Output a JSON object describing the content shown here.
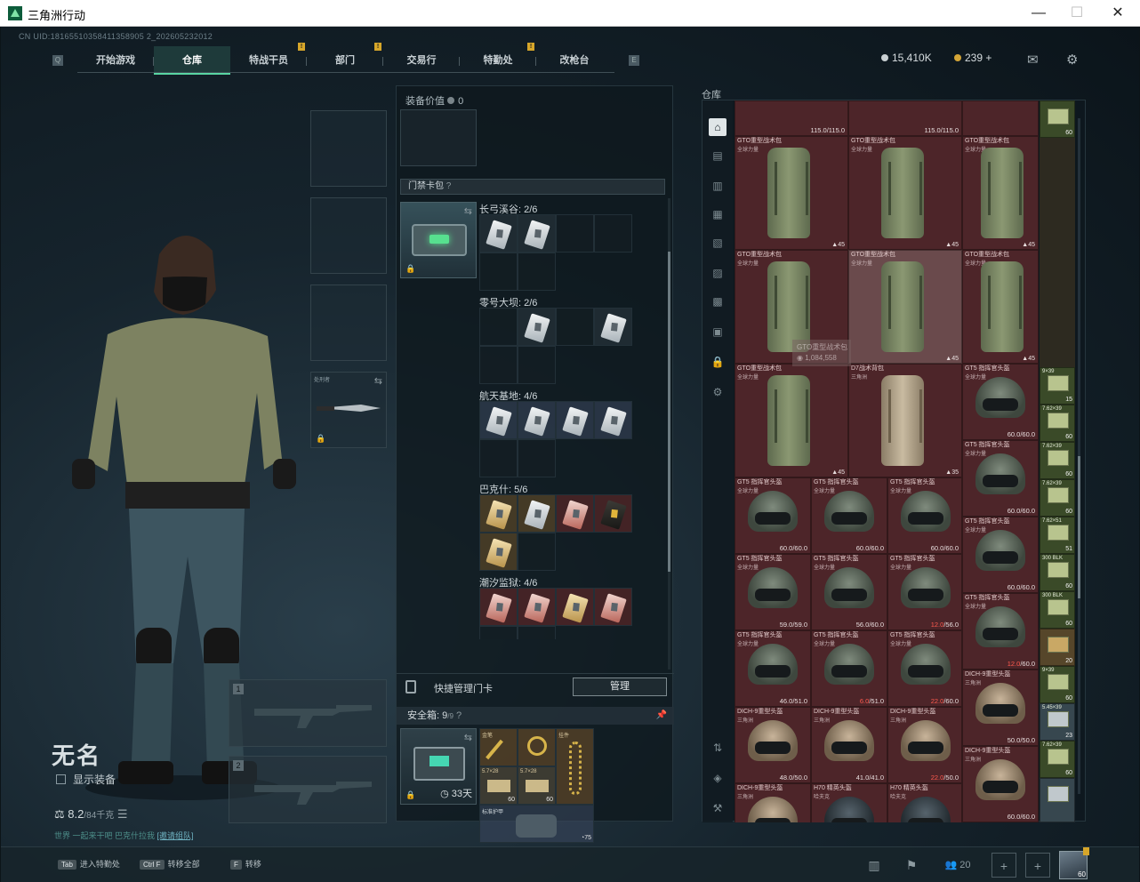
{
  "window": {
    "title": "三角洲行动",
    "min": "—",
    "max": "☐",
    "close": "✕"
  },
  "uid": "CN UID:18165510358411358905 2_202605232012",
  "nav": {
    "tabs": [
      {
        "label": "开始游戏"
      },
      {
        "label": "仓库",
        "active": true
      },
      {
        "label": "特战干员",
        "badge": "!"
      },
      {
        "label": "部门",
        "badge": "!"
      },
      {
        "label": "交易行"
      },
      {
        "label": "特勤处",
        "badge": "!"
      },
      {
        "label": "改枪台"
      }
    ],
    "left_key": "Q",
    "right_key": "E"
  },
  "currency": {
    "coins": "15,410K",
    "tokens": "239",
    "plus": "+"
  },
  "icons": {
    "mail": "mail-icon",
    "settings": "gear-icon"
  },
  "player": {
    "name": "无名",
    "show_equipment": "显示装备",
    "weight": "8.2",
    "weight_max": "/84千克",
    "invite_text": "世界 一起来干吧  巴克什拉我",
    "invite_link": "[邀请组队]"
  },
  "weapon_slots": [
    "1",
    "2"
  ],
  "melee_label": "处刑者",
  "equipment": {
    "value_label": "装备价值",
    "value": "0",
    "card_pack": "门禁卡包",
    "help": "?"
  },
  "card_groups": [
    {
      "map": "长弓溪谷: 2/6"
    },
    {
      "map": "零号大坝: 2/6"
    },
    {
      "map": "航天基地: 4/6"
    },
    {
      "map": "巴克什: 5/6"
    },
    {
      "map": "潮汐监狱: 4/6"
    }
  ],
  "quick_manage": {
    "label": "快捷管理门卡",
    "button": "管理"
  },
  "safe_box": {
    "label": "安全箱: 9",
    "cap": "/9",
    "days": "33天",
    "items": [
      {
        "name": "金笔",
        "count": ""
      },
      {
        "name": "",
        "count": ""
      },
      {
        "name": "挂件",
        "count": ""
      },
      {
        "name": "5.7×28",
        "count": "60"
      },
      {
        "name": "5.7×28",
        "count": "60"
      }
    ],
    "armor": {
      "name": "标准护甲",
      "count": "75"
    }
  },
  "storage": {
    "title": "仓库",
    "tooltip_name": "GTO重型战术包",
    "tooltip_price": "1,084,558",
    "backpack_name": "GTO重型战术包",
    "backpack_sub": "全球力量",
    "backpack_tan_name": "D7战术背包",
    "backpack_tan_sub": "三角洲",
    "backpack_dur": "115.0/115.0",
    "backpack_cap": "45",
    "backpack_tan_cap": "35",
    "gt5_name": "GT5 指挥官头盔",
    "gt5_sub": "全球力量",
    "dich_name": "DICH-9重型头盔",
    "dich_sub": "三角洲",
    "h70_name": "H70 精英头盔",
    "h70_sub": "哈夫克",
    "helmets": [
      {
        "ok": "60.0/60.0"
      },
      {
        "ok": "60.0/60.0"
      },
      {
        "ok": "60.0/60.0"
      },
      {
        "ok": "60.0/60.0"
      },
      {
        "ok": "59.0/59.0"
      },
      {
        "ok": "56.0/60.0"
      },
      {
        "bad": "12.0",
        "max": "/56.0"
      },
      {
        "bad": "12.0",
        "max": "/60.0"
      },
      {
        "ok": "46.0/51.0"
      },
      {
        "bad": "6.0",
        "max": "/51.0"
      },
      {
        "bad": "22.0",
        "max": "/60.0"
      },
      {
        "ok": "50.0/50.0"
      },
      {
        "ok": "48.0/50.0"
      },
      {
        "ok": "41.0/41.0"
      },
      {
        "bad": "22.0",
        "max": "/50.0"
      },
      {
        "ok": "60.0/60.0"
      },
      {
        "ok": "60.0/60.0"
      }
    ],
    "ammo": [
      {
        "name": "",
        "count": "60"
      },
      {
        "name": "9×39",
        "count": "15"
      },
      {
        "name": "7.62×39",
        "count": "60"
      },
      {
        "name": "7.62×39",
        "count": "60"
      },
      {
        "name": "7.62×39",
        "count": "60"
      },
      {
        "name": "7.62×51",
        "count": "51"
      },
      {
        "name": "300 BLK",
        "count": "60"
      },
      {
        "name": "300 BLK",
        "count": "60"
      },
      {
        "name": "",
        "count": "20"
      },
      {
        "name": "9×39",
        "count": "60"
      },
      {
        "name": "5.45×39",
        "count": "23"
      },
      {
        "name": "7.62×39",
        "count": "60"
      },
      {
        "name": "",
        "count": ""
      }
    ]
  },
  "bottom": {
    "hk1_key": "Tab",
    "hk1": "进入特勤处",
    "hk2_key": "Ctrl F",
    "hk2": "转移全部",
    "hk3_key": "F",
    "hk3": "转移",
    "friends": "20",
    "plus": "+",
    "avatar_level": "60"
  }
}
